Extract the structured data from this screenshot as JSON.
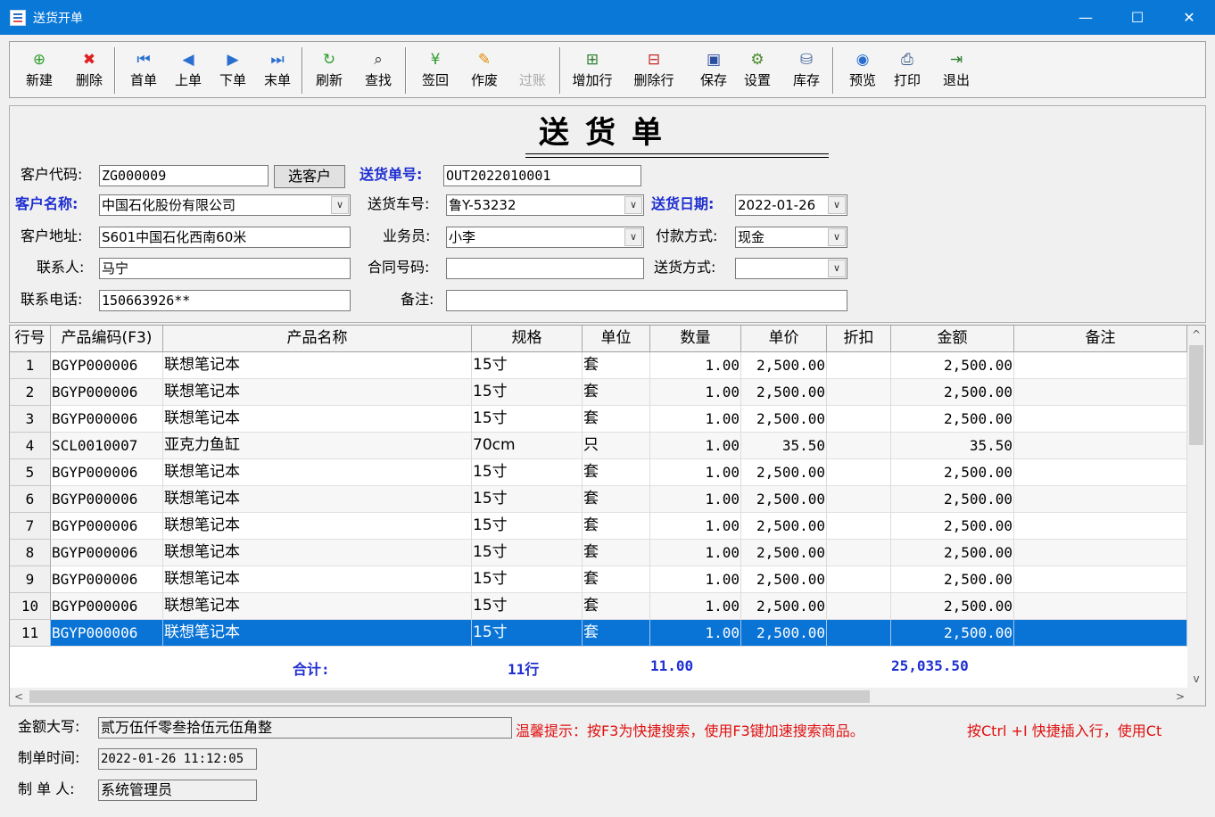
{
  "window": {
    "title": "送货开单",
    "minimize": "—",
    "maximize": "☐",
    "close": "✕"
  },
  "toolbar": [
    {
      "name": "new",
      "label": "新建",
      "icon": "plus-icon",
      "glyph": "⊕",
      "color": "#2e9e2e",
      "enabled": true
    },
    {
      "name": "delete",
      "label": "删除",
      "icon": "delete-icon",
      "glyph": "✖",
      "color": "#e02020",
      "enabled": true
    },
    {
      "name": "first",
      "label": "首单",
      "icon": "first-icon",
      "glyph": "⏮",
      "color": "#2a6fd0",
      "enabled": true
    },
    {
      "name": "prev",
      "label": "上单",
      "icon": "prev-icon",
      "glyph": "◀",
      "color": "#2a6fd0",
      "enabled": true
    },
    {
      "name": "next",
      "label": "下单",
      "icon": "next-icon",
      "glyph": "▶",
      "color": "#2a6fd0",
      "enabled": true
    },
    {
      "name": "last",
      "label": "末单",
      "icon": "last-icon",
      "glyph": "⏭",
      "color": "#2a6fd0",
      "enabled": true
    },
    {
      "name": "refresh",
      "label": "刷新",
      "icon": "refresh-icon",
      "glyph": "↻",
      "color": "#2e9e2e",
      "enabled": true
    },
    {
      "name": "find",
      "label": "查找",
      "icon": "binoculars-icon",
      "glyph": "⌕",
      "color": "#333333",
      "enabled": true
    },
    {
      "name": "signback",
      "label": "签回",
      "icon": "yen-icon",
      "glyph": "¥",
      "color": "#2e9e2e",
      "enabled": true
    },
    {
      "name": "void",
      "label": "作废",
      "icon": "void-icon",
      "glyph": "✎",
      "color": "#e08a00",
      "enabled": true
    },
    {
      "name": "post",
      "label": "过账",
      "icon": "post-icon",
      "glyph": "",
      "color": "#a8a8a8",
      "enabled": false
    },
    {
      "name": "add-row",
      "label": "增加行",
      "icon": "add-row-icon",
      "glyph": "⊞",
      "color": "#2e7d32",
      "enabled": true
    },
    {
      "name": "delete-row",
      "label": "删除行",
      "icon": "delete-row-icon",
      "glyph": "⊟",
      "color": "#c62828",
      "enabled": true
    },
    {
      "name": "save",
      "label": "保存",
      "icon": "save-icon",
      "glyph": "▣",
      "color": "#2a4fa0",
      "enabled": true
    },
    {
      "name": "settings",
      "label": "设置",
      "icon": "gear-icon",
      "glyph": "⚙",
      "color": "#4a8a2a",
      "enabled": true
    },
    {
      "name": "stock",
      "label": "库存",
      "icon": "stock-icon",
      "glyph": "⛁",
      "color": "#4a6aa0",
      "enabled": true
    },
    {
      "name": "preview",
      "label": "预览",
      "icon": "eye-icon",
      "glyph": "◉",
      "color": "#2a6fd0",
      "enabled": true
    },
    {
      "name": "print",
      "label": "打印",
      "icon": "printer-icon",
      "glyph": "⎙",
      "color": "#3a5a8a",
      "enabled": true
    },
    {
      "name": "exit",
      "label": "退出",
      "icon": "exit-icon",
      "glyph": "⇥",
      "color": "#2e7d32",
      "enabled": true
    }
  ],
  "form": {
    "title": "送货单",
    "customer_code": {
      "label": "客户代码:",
      "value": "ZG000009"
    },
    "pick_customer": "选客户",
    "order_no": {
      "label": "送货单号:",
      "value": "OUT2022010001"
    },
    "customer_name": {
      "label": "客户名称:",
      "value": "中国石化股份有限公司"
    },
    "vehicle": {
      "label": "送货车号:",
      "value": "鲁Y-53232"
    },
    "delivery_date": {
      "label": "送货日期:",
      "value": "2022-01-26"
    },
    "address": {
      "label": "客户地址:",
      "value": "S601中国石化西南60米"
    },
    "salesman": {
      "label": "业务员:",
      "value": "小李"
    },
    "payment": {
      "label": "付款方式:",
      "value": "现金"
    },
    "contact": {
      "label": "联系人:",
      "value": "马宁"
    },
    "contract_no": {
      "label": "合同号码:",
      "value": ""
    },
    "delivery_method": {
      "label": "送货方式:",
      "value": ""
    },
    "phone": {
      "label": "联系电话:",
      "value": "150663926**"
    },
    "remark": {
      "label": "备注:",
      "value": ""
    },
    "combo_arrow": "∨"
  },
  "grid": {
    "columns": [
      "行号",
      "产品编码(F3)",
      "产品名称",
      "规格",
      "单位",
      "数量",
      "单价",
      "折扣",
      "金额",
      "备注"
    ],
    "rows": [
      {
        "no": "1",
        "code": "BGYP000006",
        "name": "联想笔记本",
        "spec": "15寸",
        "unit": "套",
        "qty": "1.00",
        "price": "2,500.00",
        "discount": "",
        "amount": "2,500.00",
        "remark": ""
      },
      {
        "no": "2",
        "code": "BGYP000006",
        "name": "联想笔记本",
        "spec": "15寸",
        "unit": "套",
        "qty": "1.00",
        "price": "2,500.00",
        "discount": "",
        "amount": "2,500.00",
        "remark": ""
      },
      {
        "no": "3",
        "code": "BGYP000006",
        "name": "联想笔记本",
        "spec": "15寸",
        "unit": "套",
        "qty": "1.00",
        "price": "2,500.00",
        "discount": "",
        "amount": "2,500.00",
        "remark": ""
      },
      {
        "no": "4",
        "code": "SCL0010007",
        "name": "亚克力鱼缸",
        "spec": "70cm",
        "unit": "只",
        "qty": "1.00",
        "price": "35.50",
        "discount": "",
        "amount": "35.50",
        "remark": ""
      },
      {
        "no": "5",
        "code": "BGYP000006",
        "name": "联想笔记本",
        "spec": "15寸",
        "unit": "套",
        "qty": "1.00",
        "price": "2,500.00",
        "discount": "",
        "amount": "2,500.00",
        "remark": ""
      },
      {
        "no": "6",
        "code": "BGYP000006",
        "name": "联想笔记本",
        "spec": "15寸",
        "unit": "套",
        "qty": "1.00",
        "price": "2,500.00",
        "discount": "",
        "amount": "2,500.00",
        "remark": ""
      },
      {
        "no": "7",
        "code": "BGYP000006",
        "name": "联想笔记本",
        "spec": "15寸",
        "unit": "套",
        "qty": "1.00",
        "price": "2,500.00",
        "discount": "",
        "amount": "2,500.00",
        "remark": ""
      },
      {
        "no": "8",
        "code": "BGYP000006",
        "name": "联想笔记本",
        "spec": "15寸",
        "unit": "套",
        "qty": "1.00",
        "price": "2,500.00",
        "discount": "",
        "amount": "2,500.00",
        "remark": ""
      },
      {
        "no": "9",
        "code": "BGYP000006",
        "name": "联想笔记本",
        "spec": "15寸",
        "unit": "套",
        "qty": "1.00",
        "price": "2,500.00",
        "discount": "",
        "amount": "2,500.00",
        "remark": ""
      },
      {
        "no": "10",
        "code": "BGYP000006",
        "name": "联想笔记本",
        "spec": "15寸",
        "unit": "套",
        "qty": "1.00",
        "price": "2,500.00",
        "discount": "",
        "amount": "2,500.00",
        "remark": ""
      },
      {
        "no": "11",
        "code": "BGYP000006",
        "name": "联想笔记本",
        "spec": "15寸",
        "unit": "套",
        "qty": "1.00",
        "price": "2,500.00",
        "discount": "",
        "amount": "2,500.00",
        "remark": ""
      }
    ],
    "selected_row": 10,
    "totals": {
      "label": "合计:",
      "rows": "11行",
      "qty": "11.00",
      "amount": "25,035.50"
    },
    "scroll": {
      "up": "^",
      "down": "v",
      "left": "<",
      "right": ">"
    }
  },
  "footer": {
    "amount_words": {
      "label": "金额大写:",
      "value": "贰万伍仟零叁拾伍元伍角整"
    },
    "hint": "温馨提示：按F3为快捷搜索，使用F3键加速搜索商品。",
    "hint2": "按Ctrl +I 快捷插入行，使用Ct",
    "created_time": {
      "label": "制单时间:",
      "value": "2022-01-26 11:12:05"
    },
    "creator": {
      "label": "制 单 人:",
      "value": "系统管理员"
    }
  },
  "colors": {
    "titlebar": "#0a78d7",
    "label_blue": "#1f2fd0",
    "hint_red": "#e01010",
    "selection": "#0a74d6"
  }
}
